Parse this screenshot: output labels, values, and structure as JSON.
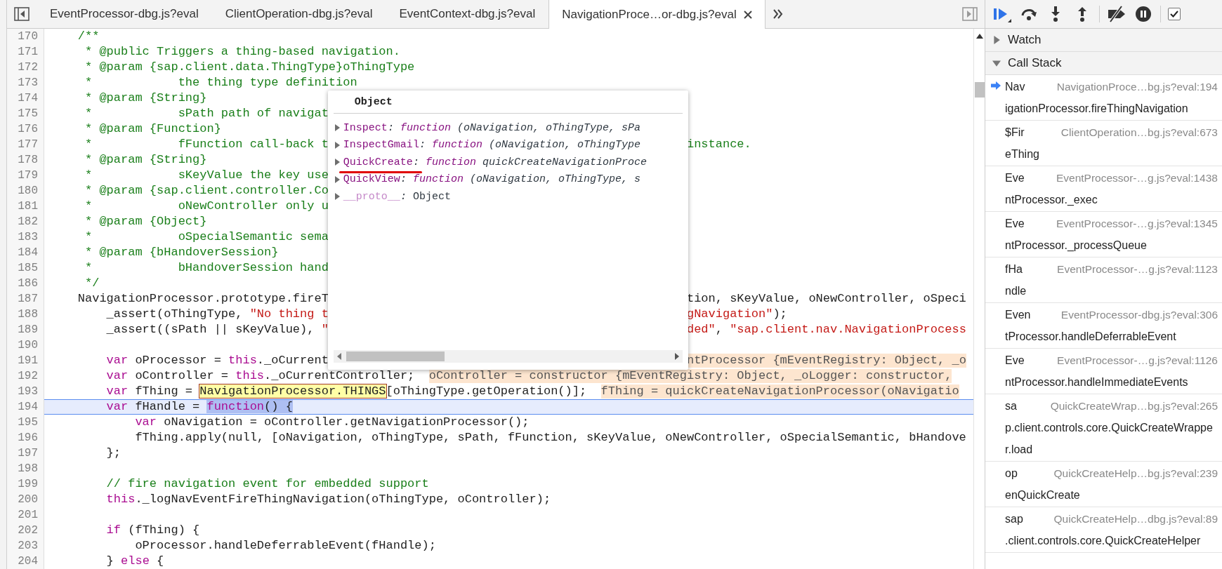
{
  "tabs": [
    {
      "label": "EventProcessor-dbg.js?eval",
      "selected": false
    },
    {
      "label": "ClientOperation-dbg.js?eval",
      "selected": false
    },
    {
      "label": "EventContext-dbg.js?eval",
      "selected": false
    },
    {
      "label": "NavigationProce…or-dbg.js?eval",
      "selected": true
    }
  ],
  "lines": [
    {
      "number": "170",
      "current": false,
      "code": [
        {
          "kind": "comment",
          "text": "    /**"
        }
      ]
    },
    {
      "number": "171",
      "current": false,
      "code": [
        {
          "kind": "comment",
          "text": "     * @public Triggers a thing-based navigation."
        }
      ]
    },
    {
      "number": "172",
      "current": false,
      "code": [
        {
          "kind": "comment",
          "text": "     * @param {sap.client.data.ThingType}oThingType"
        }
      ]
    },
    {
      "number": "173",
      "current": false,
      "code": [
        {
          "kind": "comment",
          "text": "     *            the thing type definition"
        }
      ]
    },
    {
      "number": "174",
      "current": false,
      "code": [
        {
          "kind": "comment",
          "text": "     * @param {String}"
        }
      ]
    },
    {
      "number": "175",
      "current": false,
      "code": [
        {
          "kind": "comment",
          "text": "     *            sPath path of navigat"
        }
      ]
    },
    {
      "number": "176",
      "current": false,
      "code": [
        {
          "kind": "comment",
          "text": "     * @param {Function}"
        }
      ]
    },
    {
      "number": "177",
      "current": false,
      "code": [
        {
          "kind": "comment",
          "text": "     *            fFunction call-back t"
        }
      ],
      "after_popover": [
        {
          "kind": "comment",
          "text": "instance."
        }
      ]
    },
    {
      "number": "178",
      "current": false,
      "code": [
        {
          "kind": "comment",
          "text": "     * @param {String}"
        }
      ]
    },
    {
      "number": "179",
      "current": false,
      "code": [
        {
          "kind": "comment",
          "text": "     *            sKeyValue the key use"
        }
      ]
    },
    {
      "number": "180",
      "current": false,
      "code": [
        {
          "kind": "comment",
          "text": "     * @param {sap.client.controller.Co"
        }
      ]
    },
    {
      "number": "181",
      "current": false,
      "code": [
        {
          "kind": "comment",
          "text": "     *            oNewController only u"
        }
      ]
    },
    {
      "number": "182",
      "current": false,
      "code": [
        {
          "kind": "comment",
          "text": "     * @param {Object}"
        }
      ]
    },
    {
      "number": "183",
      "current": false,
      "code": [
        {
          "kind": "comment",
          "text": "     *            oSpecialSemantic sema"
        }
      ]
    },
    {
      "number": "184",
      "current": false,
      "code": [
        {
          "kind": "comment",
          "text": "     * @param {bHandoverSession}"
        }
      ]
    },
    {
      "number": "185",
      "current": false,
      "code": [
        {
          "kind": "comment",
          "text": "     *            bHandoverSession hand"
        }
      ]
    },
    {
      "number": "186",
      "current": false,
      "code": [
        {
          "kind": "comment",
          "text": "     */"
        }
      ]
    },
    {
      "number": "187",
      "current": false,
      "code": [
        {
          "kind": "plain",
          "text": "    NavigationProcessor.prototype.fireT"
        }
      ],
      "after_popover": [
        {
          "kind": "plain",
          "text": "tion, sKeyValue, oNewController, oSpeci"
        }
      ]
    },
    {
      "number": "188",
      "current": false,
      "code": [
        {
          "kind": "plain",
          "text": "        _assert(oThingType, "
        },
        {
          "kind": "string",
          "text": "\"No thing t"
        }
      ],
      "after_popover": [
        {
          "kind": "string",
          "text": "gNavigation\""
        },
        {
          "kind": "plain",
          "text": ");"
        }
      ]
    },
    {
      "number": "189",
      "current": false,
      "code": [
        {
          "kind": "plain",
          "text": "        _assert((sPath || sKeyValue), "
        },
        {
          "kind": "string",
          "text": "\""
        }
      ],
      "after_popover": [
        {
          "kind": "string",
          "text": "ded\""
        },
        {
          "kind": "plain",
          "text": ", "
        },
        {
          "kind": "string",
          "text": "\"sap.client.nav.NavigationProcess"
        }
      ]
    },
    {
      "number": "190",
      "current": false
    },
    {
      "number": "191",
      "current": false,
      "code": [
        {
          "kind": "keyword",
          "text": "        var"
        },
        {
          "kind": "plain",
          "text": " oProcessor = "
        },
        {
          "kind": "keyword",
          "text": "this"
        },
        {
          "kind": "plain",
          "text": "._oCurrent"
        }
      ],
      "after_popover": [
        {
          "kind": "inline-value",
          "text": "ntProcessor {mEventRegistry: Object, _o"
        }
      ]
    },
    {
      "number": "192",
      "current": false,
      "code": [
        {
          "kind": "keyword",
          "text": "        var"
        },
        {
          "kind": "plain",
          "text": " oController = "
        },
        {
          "kind": "keyword",
          "text": "this"
        },
        {
          "kind": "plain",
          "text": "._oCurrentController;"
        },
        {
          "kind": "inline-value",
          "text": "oController = constructor {mEventRegistry: Object, _oLogger: constructor,"
        }
      ]
    },
    {
      "number": "193",
      "current": false,
      "code": [
        {
          "kind": "keyword",
          "text": "        var"
        },
        {
          "kind": "plain",
          "text": " fThing = "
        },
        {
          "kind": "hover",
          "text": "NavigationProcessor.THINGS"
        },
        {
          "kind": "plain",
          "text": "[oThingType.getOperation()];"
        },
        {
          "kind": "inline-value",
          "text": "fThing = quickCreateNavigationProcessor(oNavigatio"
        }
      ]
    },
    {
      "number": "194",
      "current": true,
      "code": [
        {
          "kind": "keyword",
          "text": "        var"
        },
        {
          "kind": "plain",
          "text": " fHandle = "
        },
        {
          "kind": "selected-keyword",
          "text": "function"
        },
        {
          "kind": "selected-plain",
          "text": "() {"
        }
      ]
    },
    {
      "number": "195",
      "current": false,
      "code": [
        {
          "kind": "keyword",
          "text": "            var"
        },
        {
          "kind": "plain",
          "text": " oNavigation = oController.getNavigationProcessor();"
        }
      ]
    },
    {
      "number": "196",
      "current": false,
      "code": [
        {
          "kind": "plain",
          "text": "            fThing.apply(null, [oNavigation, oThingType, sPath, fFunction, sKeyValue, oNewController, oSpecialSemantic, bHandove"
        }
      ]
    },
    {
      "number": "197",
      "current": false,
      "code": [
        {
          "kind": "plain",
          "text": "        };"
        }
      ]
    },
    {
      "number": "198",
      "current": false
    },
    {
      "number": "199",
      "current": false,
      "code": [
        {
          "kind": "comment",
          "text": "        // fire navigation event for embedded support"
        }
      ]
    },
    {
      "number": "200",
      "current": false,
      "code": [
        {
          "kind": "keyword",
          "text": "        this"
        },
        {
          "kind": "plain",
          "text": "._logNavEventFireThingNavigation(oThingType, oController);"
        }
      ]
    },
    {
      "number": "201",
      "current": false
    },
    {
      "number": "202",
      "current": false,
      "code": [
        {
          "kind": "keyword",
          "text": "        if"
        },
        {
          "kind": "plain",
          "text": " (fThing) {"
        }
      ]
    },
    {
      "number": "203",
      "current": false,
      "code": [
        {
          "kind": "plain",
          "text": "            oProcessor.handleDeferrableEvent(fHandle);"
        }
      ]
    },
    {
      "number": "204",
      "current": false,
      "code": [
        {
          "kind": "plain",
          "text": "        } "
        },
        {
          "kind": "keyword",
          "text": "else"
        },
        {
          "kind": "plain",
          "text": " {"
        }
      ]
    }
  ],
  "popover": {
    "title": "Object",
    "properties": [
      {
        "kind": "method",
        "name": "Inspect",
        "separator": ": ",
        "keyword": "function",
        "value": " (oNavigation, oThingType, sPa",
        "expanded": false,
        "underlined": false
      },
      {
        "kind": "method",
        "name": "InspectGmail",
        "separator": ": ",
        "keyword": "function",
        "value": " (oNavigation, oThingType",
        "expanded": false,
        "underlined": false
      },
      {
        "kind": "method",
        "name": "QuickCreate",
        "separator": ": ",
        "keyword": "function",
        "value": " quickCreateNavigationProce",
        "expanded": false,
        "underlined": true
      },
      {
        "kind": "method",
        "name": "QuickView",
        "separator": ": ",
        "keyword": "function",
        "value": " (oNavigation, oThingType, s",
        "expanded": false,
        "underlined": false
      },
      {
        "kind": "prototype",
        "name": "__proto__",
        "separator": ": ",
        "value": "Object",
        "expanded": false,
        "underlined": false
      }
    ]
  },
  "debugger_toolbar": {
    "checkbox": {
      "checked": true
    }
  },
  "sidebar": {
    "sections": [
      {
        "label": "Watch",
        "expanded": false
      },
      {
        "label": "Call Stack",
        "expanded": true,
        "frames": [
          {
            "head": "Nav",
            "location": "NavigationProce…bg.js?eval:194",
            "tail": "igationProcessor.fireThingNavigation",
            "current": true
          },
          {
            "head": "$Fir",
            "location": "ClientOperation…bg.js?eval:673",
            "tail": "eThing",
            "current": false
          },
          {
            "head": "Eve",
            "location": "EventProcessor-…g.js?eval:1438",
            "tail": "ntProcessor._exec",
            "current": false
          },
          {
            "head": "Eve",
            "location": "EventProcessor-…g.js?eval:1345",
            "tail": "ntProcessor._processQueue",
            "current": false
          },
          {
            "head": "fHa",
            "location": "EventProcessor-…g.js?eval:1123",
            "tail": "ndle",
            "current": false
          },
          {
            "head": "Even",
            "location": "EventProcessor-dbg.js?eval:306",
            "tail": "tProcessor.handleDeferrableEvent",
            "current": false
          },
          {
            "head": "Eve",
            "location": "EventProcessor-…g.js?eval:1126",
            "tail": "ntProcessor.handleImmediateEvents",
            "current": false
          },
          {
            "head": "sa",
            "location": "QuickCreateWrap…bg.js?eval:265",
            "tail": "p.client.controls.core.QuickCreateWrapper.load",
            "current": false
          },
          {
            "head": "op",
            "location": "QuickCreateHelp…bg.js?eval:239",
            "tail": "enQuickCreate",
            "current": false
          },
          {
            "head": "sap",
            "location": "QuickCreateHelp…dbg.js?eval:89",
            "tail": ".client.controls.core.QuickCreateHelper",
            "current": false
          }
        ]
      }
    ]
  }
}
